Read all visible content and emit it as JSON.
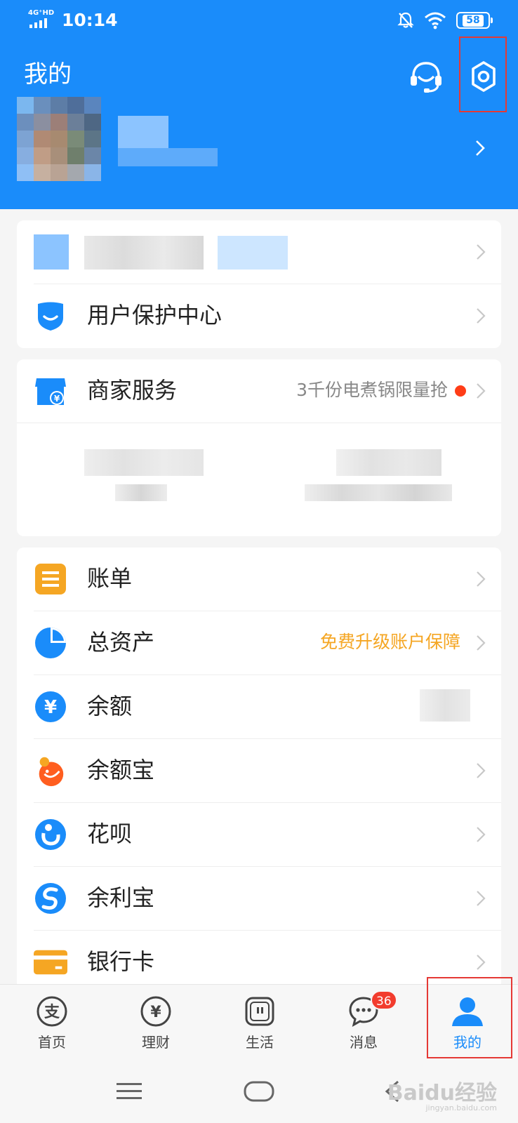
{
  "status_bar": {
    "network": "4G⁺HD",
    "time": "10:14",
    "battery": "58"
  },
  "header": {
    "title": "我的",
    "customer_service_icon": "headset-icon",
    "settings_icon": "gear-icon"
  },
  "profile_card": {
    "items": [
      {
        "label": "用户保护中心",
        "icon": "shield-icon"
      }
    ]
  },
  "merchant_card": {
    "label": "商家服务",
    "icon": "shop-icon",
    "promo_text": "3千份电煮锅限量抢"
  },
  "list_card": {
    "items": [
      {
        "label": "账单",
        "icon": "bill-icon"
      },
      {
        "label": "总资产",
        "icon": "pie-chart-icon",
        "right_text": "免费升级账户保障"
      },
      {
        "label": "余额",
        "icon": "yuan-icon"
      },
      {
        "label": "余额宝",
        "icon": "yuebao-icon"
      },
      {
        "label": "花呗",
        "icon": "huabei-icon"
      },
      {
        "label": "余利宝",
        "icon": "yulibao-icon"
      },
      {
        "label": "银行卡",
        "icon": "bank-card-icon"
      }
    ]
  },
  "tabbar": {
    "tabs": [
      {
        "label": "首页",
        "icon": "alipay-home-icon"
      },
      {
        "label": "理财",
        "icon": "finance-icon"
      },
      {
        "label": "生活",
        "icon": "life-icon"
      },
      {
        "label": "消息",
        "icon": "chat-icon",
        "badge": "36"
      },
      {
        "label": "我的",
        "icon": "person-icon",
        "active": true
      }
    ]
  },
  "colors": {
    "brand": "#1a8cfa",
    "highlight_box": "#e53935",
    "promo_orange": "#f5a623",
    "notification_red": "#f23c2e"
  },
  "watermark": {
    "text": "Baidu经验",
    "url_text": "jingyan.baidu.com"
  }
}
